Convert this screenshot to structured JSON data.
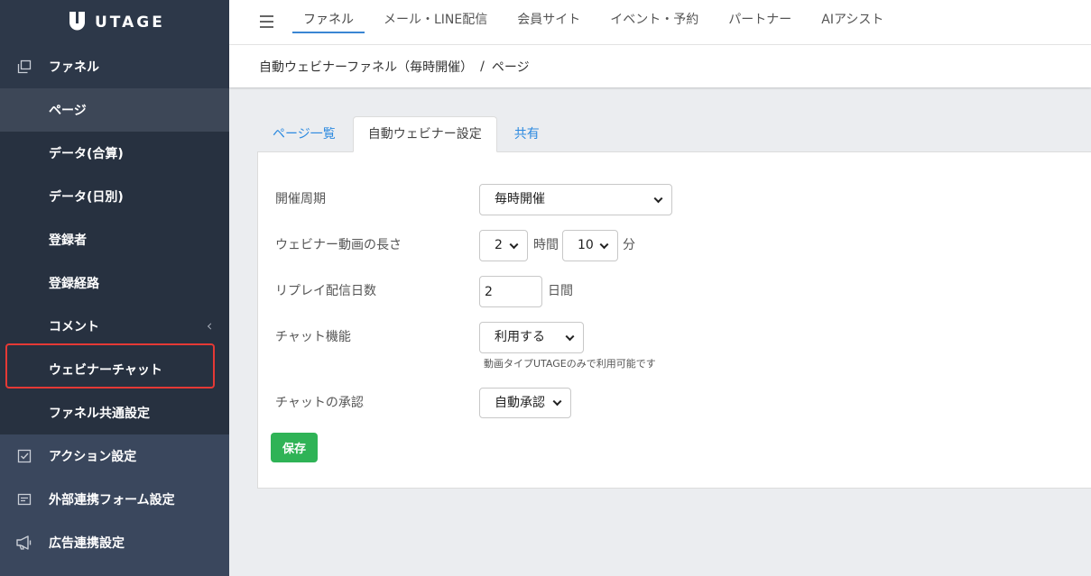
{
  "app": {
    "logo_text": "UTAGE",
    "logo_icon": "utage-logo-icon"
  },
  "sidebar": {
    "funnel": {
      "label": "ファネル",
      "icon": "pages-icon"
    },
    "sub_items": [
      {
        "label": "ページ",
        "active": true
      },
      {
        "label": "データ(合算)"
      },
      {
        "label": "データ(日別)"
      },
      {
        "label": "登録者"
      },
      {
        "label": "登録経路"
      },
      {
        "label": "コメント",
        "icon": "chevron-left-icon"
      },
      {
        "label": "ウェビナーチャット",
        "highlighted": true
      },
      {
        "label": "ファネル共通設定"
      }
    ],
    "items": [
      {
        "label": "アクション設定",
        "icon": "checkbox-icon"
      },
      {
        "label": "外部連携フォーム設定",
        "icon": "form-icon"
      },
      {
        "label": "広告連携設定",
        "icon": "megaphone-icon"
      }
    ]
  },
  "topnav": {
    "menu_icon": "hamburger-icon",
    "tabs": [
      {
        "label": "ファネル",
        "active": true
      },
      {
        "label": "メール・LINE配信"
      },
      {
        "label": "会員サイト"
      },
      {
        "label": "イベント・予約"
      },
      {
        "label": "パートナー"
      },
      {
        "label": "AIアシスト"
      }
    ]
  },
  "breadcrumb": {
    "parent": "自動ウェビナーファネル（毎時開催）",
    "separator": "/",
    "current": "ページ"
  },
  "page_tabs": [
    {
      "label": "ページ一覧"
    },
    {
      "label": "自動ウェビナー設定",
      "active": true
    },
    {
      "label": "共有"
    }
  ],
  "form": {
    "schedule": {
      "label": "開催周期",
      "value": "毎時開催"
    },
    "video_length": {
      "label": "ウェビナー動画の長さ",
      "hours": "2",
      "hours_unit": "時間",
      "minutes": "10",
      "minutes_unit": "分"
    },
    "replay_days": {
      "label": "リプレイ配信日数",
      "value": "2",
      "unit": "日間"
    },
    "chat": {
      "label": "チャット機能",
      "value": "利用する",
      "help": "動画タイプUTAGEのみで利用可能です"
    },
    "chat_approval": {
      "label": "チャットの承認",
      "value": "自動承認"
    },
    "save_label": "保存"
  },
  "colors": {
    "sidebar_bg": "#3a475d",
    "sidebar_active": "#3d4757",
    "nav_accent": "#3a86d3",
    "link": "#2d8ae0",
    "save_button": "#2fb356",
    "highlight": "#e53935"
  }
}
